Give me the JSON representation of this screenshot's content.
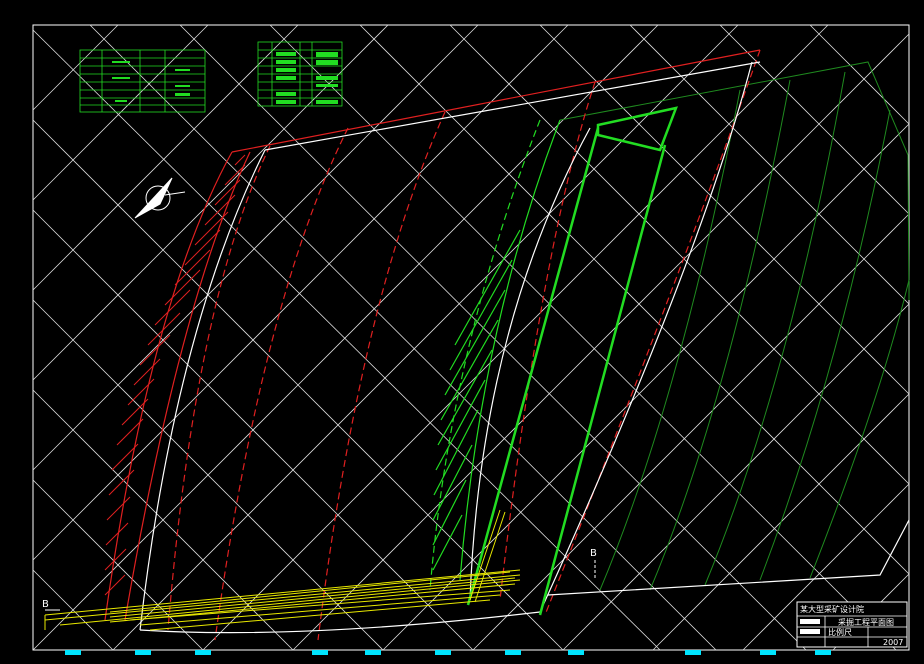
{
  "viewport": {
    "background": "#000000"
  },
  "colors": {
    "red": "#e02020",
    "green": "#22dd22",
    "dark_green": "#1f8a1f",
    "white": "#ffffff",
    "yellow": "#e8e800",
    "cyan": "#00e5ff"
  },
  "section_labels": {
    "left": "B",
    "right": "B"
  },
  "title_block": {
    "org": "某大型采矿设计院",
    "drawing_name": "采掘工程平面图",
    "scale_label": "比例尺",
    "year": "2007"
  },
  "icons": [
    "north-arrow-icon"
  ]
}
